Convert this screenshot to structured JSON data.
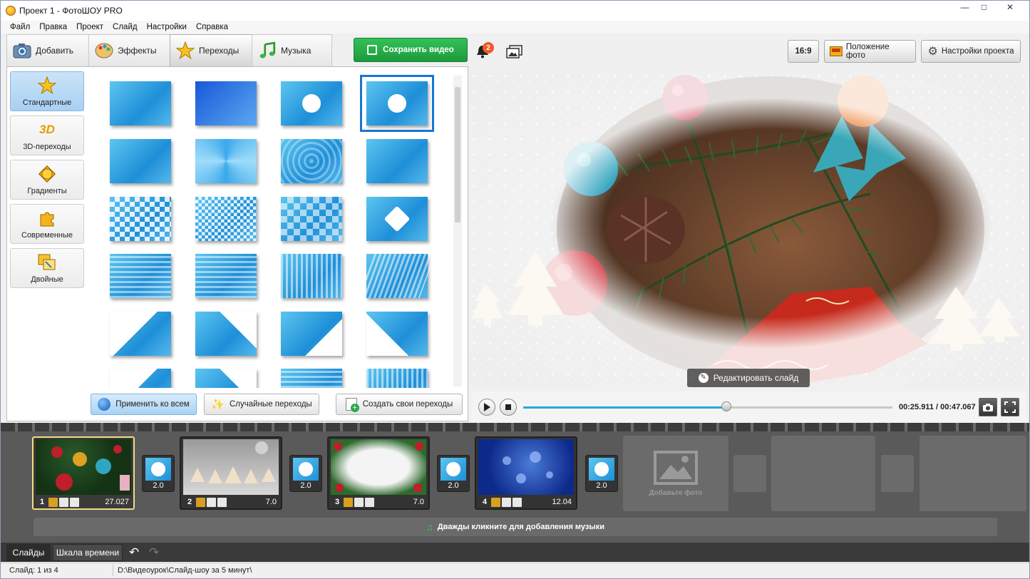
{
  "window": {
    "title": "Проект 1 - ФотоШОУ PRO"
  },
  "menu": [
    "Файл",
    "Правка",
    "Проект",
    "Слайд",
    "Настройки",
    "Справка"
  ],
  "tabs": [
    "Добавить",
    "Эффекты",
    "Переходы",
    "Музыка"
  ],
  "save_button": "Сохранить видео",
  "notifications_count": "2",
  "toolbar_right": {
    "aspect": "16:9",
    "photo_position": "Положение фото",
    "project_settings": "Настройки проекта"
  },
  "categories": [
    "Стандартные",
    "3D-переходы",
    "Градиенты",
    "Современные",
    "Двойные"
  ],
  "category_3d_glyph": "3D",
  "panel_buttons": {
    "apply_all": "Применить ко всем",
    "random": "Случайные переходы",
    "create": "Создать свои переходы"
  },
  "preview": {
    "edit_slide": "Редактировать слайд",
    "time": "00:25.911 / 00:47.067",
    "progress": 0.55
  },
  "slides": [
    {
      "num": "1",
      "duration": "27.027"
    },
    {
      "num": "2",
      "duration": "7.0"
    },
    {
      "num": "3",
      "duration": "7.0"
    },
    {
      "num": "4",
      "duration": "12.04"
    }
  ],
  "transitions": [
    "2.0",
    "2.0",
    "2.0",
    "2.0"
  ],
  "add_photo": "Добавьте фото",
  "music_hint": "Дважды кликните для добавления музыки",
  "bottom_tabs": [
    "Слайды",
    "Шкала времени"
  ],
  "status": {
    "slide": "Слайд: 1 из 4",
    "path": "D:\\Видеоурок\\Слайд-шоу за 5 минут\\"
  },
  "colors": {
    "accent": "#1775d1",
    "save": "#22a845",
    "film": "#5a5a5a"
  }
}
